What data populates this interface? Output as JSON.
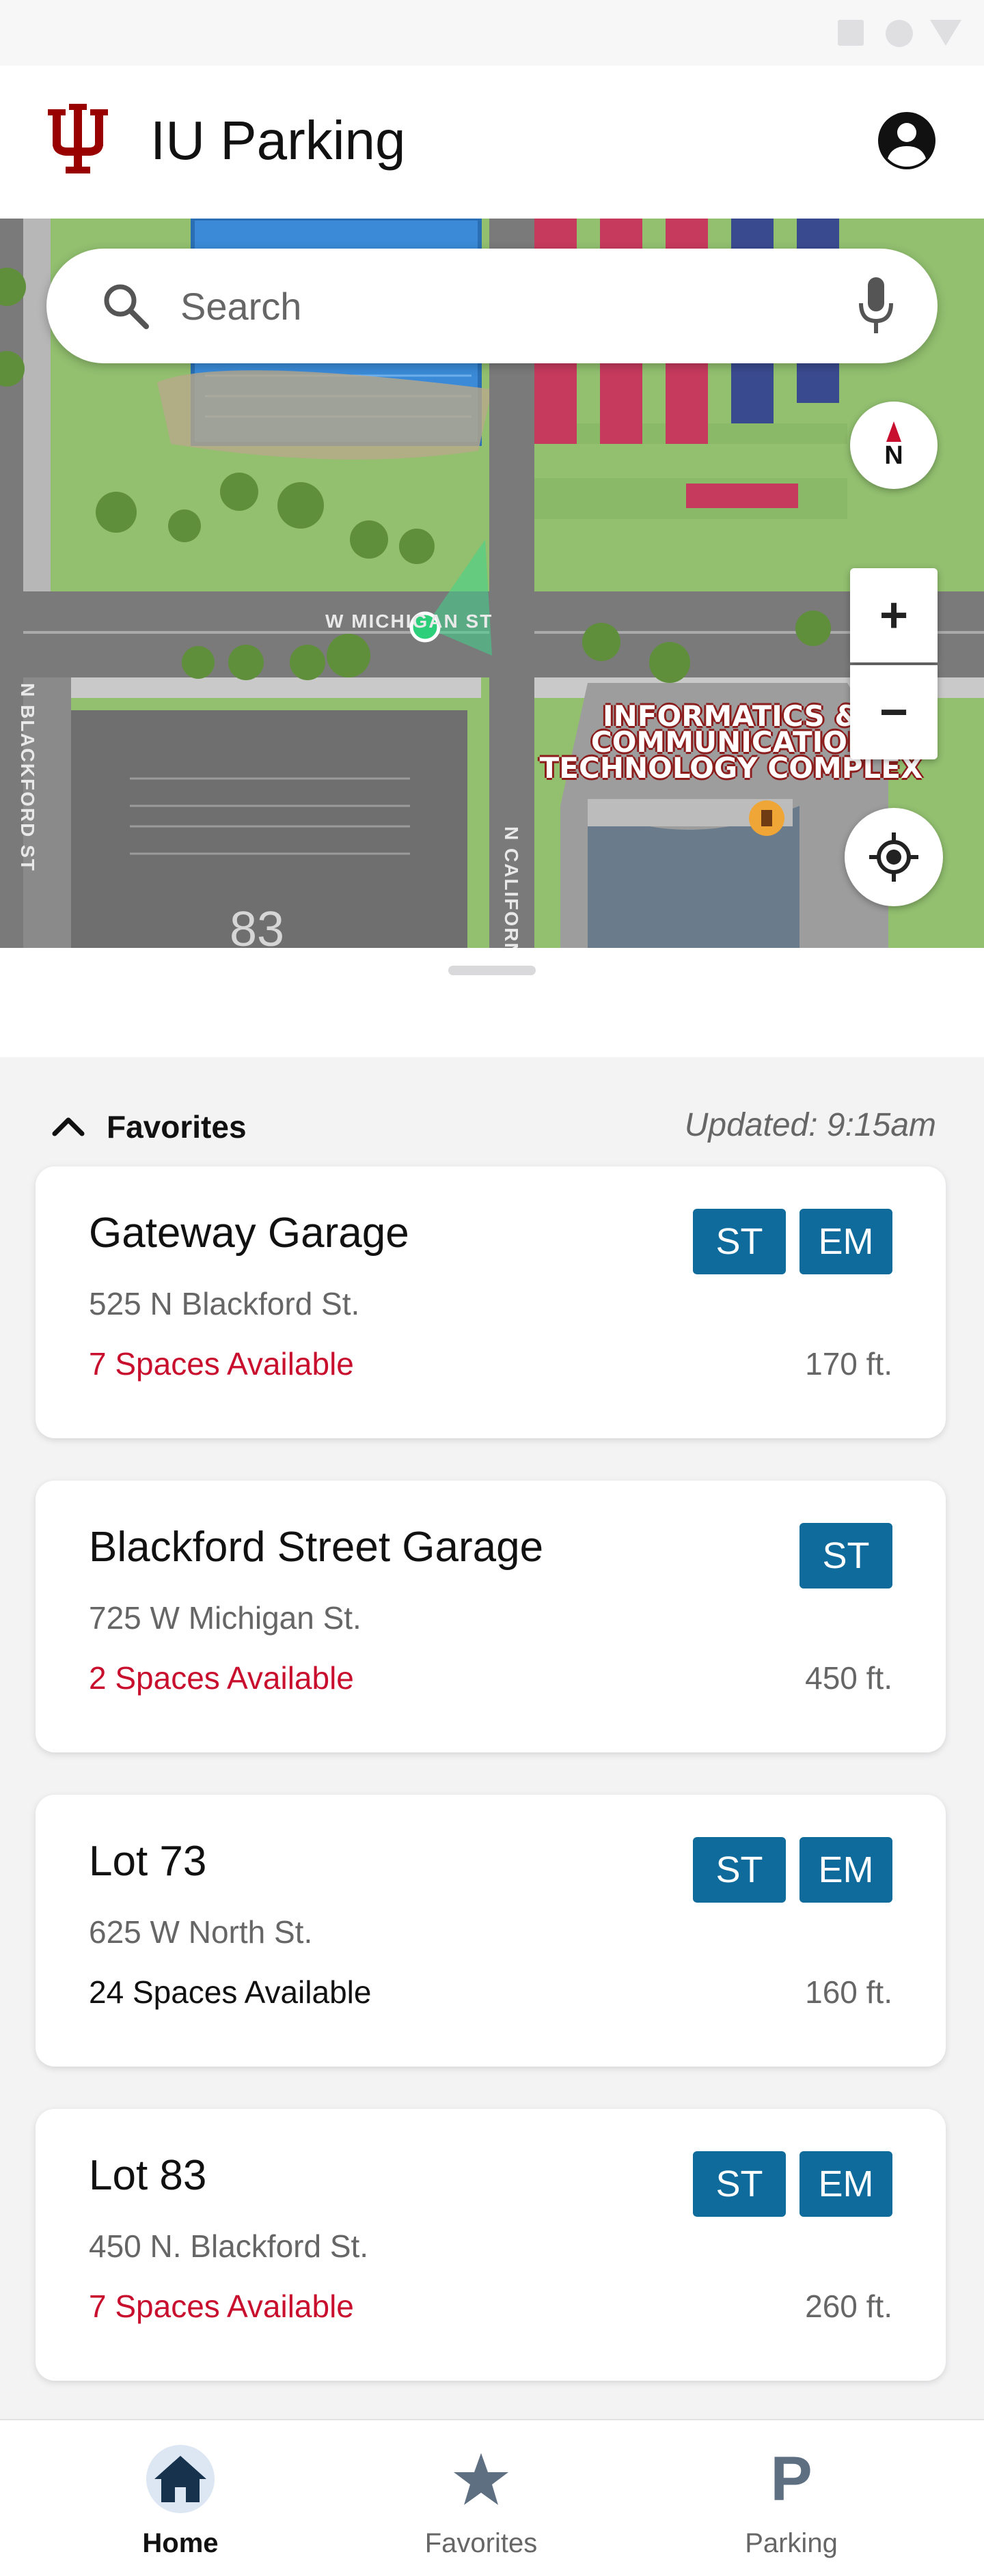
{
  "app": {
    "title": "IU Parking"
  },
  "colors": {
    "brand": "#990000",
    "badge": "#0f6b9c",
    "spaces_low": "#c8102e",
    "spaces_ok": "#111111"
  },
  "icons": {
    "logo": "iu-trident-logo",
    "account": "account-circle-icon",
    "search": "search-icon",
    "mic": "mic-icon",
    "compass": "compass-icon",
    "locate": "my-location-icon"
  },
  "search": {
    "placeholder": "Search"
  },
  "map": {
    "compass_label": "N",
    "zoom_in": "+",
    "zoom_out": "−",
    "streets": {
      "michigan": "W MICHIGAN ST",
      "blackford": "N BLACKFORD ST",
      "california": "N CALIFORN"
    },
    "lot_number": "83",
    "building_label": [
      "INFORMATICS &",
      "COMMUNICATION",
      "TECHNOLOGY COMPLEX"
    ]
  },
  "favorites": {
    "title": "Favorites",
    "updated": "Updated: 9:15am",
    "items": [
      {
        "name": "Gateway Garage",
        "address": "525 N Blackford St.",
        "spaces": "7 Spaces Available",
        "spaces_low": true,
        "distance": "170 ft.",
        "badges": [
          "ST",
          "EM"
        ]
      },
      {
        "name": "Blackford Street Garage",
        "address": "725 W Michigan St.",
        "spaces": "2 Spaces Available",
        "spaces_low": true,
        "distance": "450 ft.",
        "badges": [
          "ST"
        ]
      },
      {
        "name": "Lot 73",
        "address": "625 W North St.",
        "spaces": "24 Spaces Available",
        "spaces_low": false,
        "distance": "160 ft.",
        "badges": [
          "ST",
          "EM"
        ]
      },
      {
        "name": "Lot 83",
        "address": "450 N. Blackford St.",
        "spaces": "7 Spaces Available",
        "spaces_low": true,
        "distance": "260 ft.",
        "badges": [
          "ST",
          "EM"
        ]
      }
    ]
  },
  "nav": {
    "items": [
      {
        "label": "Home",
        "icon": "home-icon",
        "active": true
      },
      {
        "label": "Favorites",
        "icon": "star-icon",
        "active": false
      },
      {
        "label": "Parking",
        "icon": "parking-icon",
        "active": false
      }
    ]
  }
}
